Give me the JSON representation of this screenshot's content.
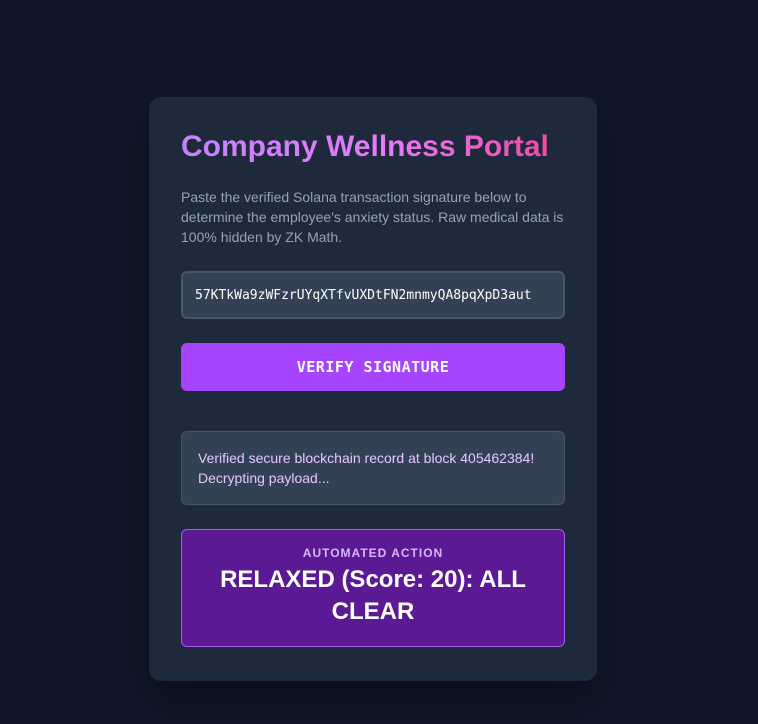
{
  "portal": {
    "title": "Company Wellness Portal",
    "description": "Paste the verified Solana transaction signature below to determine the employee's anxiety status. Raw medical data is 100% hidden by ZK Math.",
    "signature_value": "57KTkWa9zWFzrUYqXTfvUXDtFN2mnmyQA8pqXpD3aut",
    "verify_label": "VERIFY SIGNATURE",
    "status_message": "Verified secure blockchain record at block 405462384! Decrypting payload...",
    "action_label": "AUTOMATED ACTION",
    "action_result": "RELAXED (Score: 20): ALL CLEAR"
  },
  "colors": {
    "background": "#0f1729",
    "card": "#1e293b",
    "accent": "#a744ff",
    "action_bg": "#5b1a94"
  }
}
